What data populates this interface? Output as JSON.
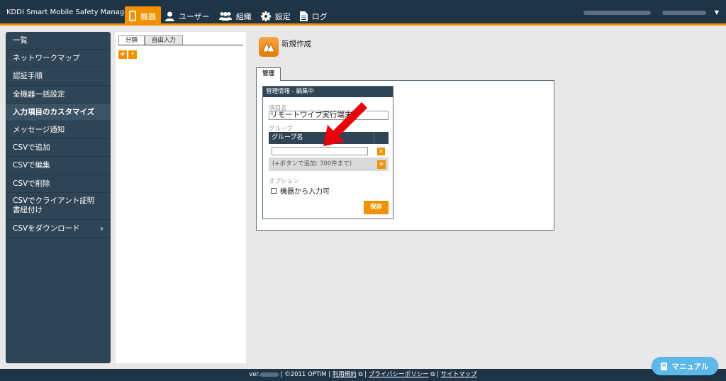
{
  "header": {
    "brand": "KDDI Smart Mobile Safety Manager",
    "nav": [
      {
        "label": "機器",
        "icon": "smartphone-icon",
        "active": true
      },
      {
        "label": "ユーザー",
        "icon": "user-icon",
        "active": false
      },
      {
        "label": "組織",
        "icon": "group-icon",
        "active": false
      },
      {
        "label": "設定",
        "icon": "gear-icon",
        "active": false
      },
      {
        "label": "ログ",
        "icon": "document-icon",
        "active": false
      }
    ]
  },
  "sidebar": {
    "items": [
      {
        "label": "一覧"
      },
      {
        "label": "ネットワークマップ"
      },
      {
        "label": "認証手順"
      },
      {
        "label": "全機器一括設定"
      },
      {
        "label": "入力項目のカスタマイズ"
      },
      {
        "label": "メッセージ通知"
      },
      {
        "label": "CSVで追加"
      },
      {
        "label": "CSVで編集"
      },
      {
        "label": "CSVで削除"
      },
      {
        "label": "CSVでクライアント証明書紐付け"
      },
      {
        "label": "CSVをダウンロード"
      }
    ]
  },
  "tree": {
    "tabs": [
      "分類",
      "自由入力"
    ]
  },
  "main": {
    "new_create": "新規作成",
    "tab_label": "管理",
    "card": {
      "title": "管理情報 - 編集中",
      "item_name_label": "項目名",
      "item_name_value": "リモートワイプ実行端末",
      "group_label": "グループ",
      "group_column": "グループ名",
      "group_input_value": "",
      "add_hint": "(+ボタンで追加: 300件まで)",
      "option_label": "オプション",
      "checkbox_label": "機器から入力可",
      "checkbox_checked": false,
      "save_label": "保存"
    }
  },
  "footer": {
    "ver_prefix": "ver.",
    "copyright": "| ©2011 OPTiM |",
    "terms": "利用規約",
    "sep1": "|",
    "privacy": "プライバシーポリシー",
    "sep2": "|",
    "sitemap": "サイトマップ"
  },
  "manual_button": "マニュアル",
  "colors": {
    "accent": "#f29100",
    "navy": "#1f3447",
    "sidebar": "#2f4556",
    "arrow": "#e8000b",
    "manual": "#5bb8e8"
  }
}
